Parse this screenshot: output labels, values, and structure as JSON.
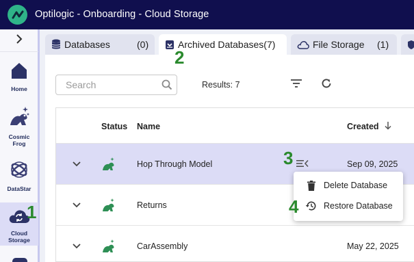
{
  "app": {
    "title": "Optilogic - Onboarding - Cloud Storage"
  },
  "sidebar": {
    "items": [
      {
        "label": "Home",
        "icon": "home-icon"
      },
      {
        "label": "Cosmic Frog",
        "icon": "cosmic-frog-icon"
      },
      {
        "label": "DataStar",
        "icon": "datastar-icon"
      },
      {
        "label": "Cloud Storage",
        "icon": "cloud-storage-icon",
        "active": true
      }
    ]
  },
  "tabs": [
    {
      "label": "Databases",
      "count": "(0)",
      "icon": "database-icon"
    },
    {
      "label": "Archived Databases(7)",
      "icon": "archive-icon",
      "active": true
    },
    {
      "label": "File Storage",
      "count": "(1)",
      "icon": "cloud-icon"
    }
  ],
  "toolbar": {
    "search_placeholder": "Search",
    "results": "Results: 7"
  },
  "table": {
    "columns": [
      "Status",
      "Name",
      "Created"
    ],
    "rows": [
      {
        "name": "Hop Through Model",
        "created": "Sep 09, 2025",
        "selected": true
      },
      {
        "name": "Returns",
        "created": ""
      },
      {
        "name": "CarAssembly",
        "created": "May 22, 2025"
      }
    ]
  },
  "context_menu": {
    "items": [
      {
        "label": "Delete Database",
        "icon": "trash-icon"
      },
      {
        "label": "Restore Database",
        "icon": "restore-icon"
      }
    ]
  },
  "steps": [
    "1",
    "2",
    "3",
    "4"
  ],
  "colors": {
    "titlebar": "#100f4e",
    "brand_green": "#2fb489",
    "selected_row": "#dcdcf6",
    "step_marker": "#2b8a2e",
    "frog_status": "#2e8f55"
  }
}
